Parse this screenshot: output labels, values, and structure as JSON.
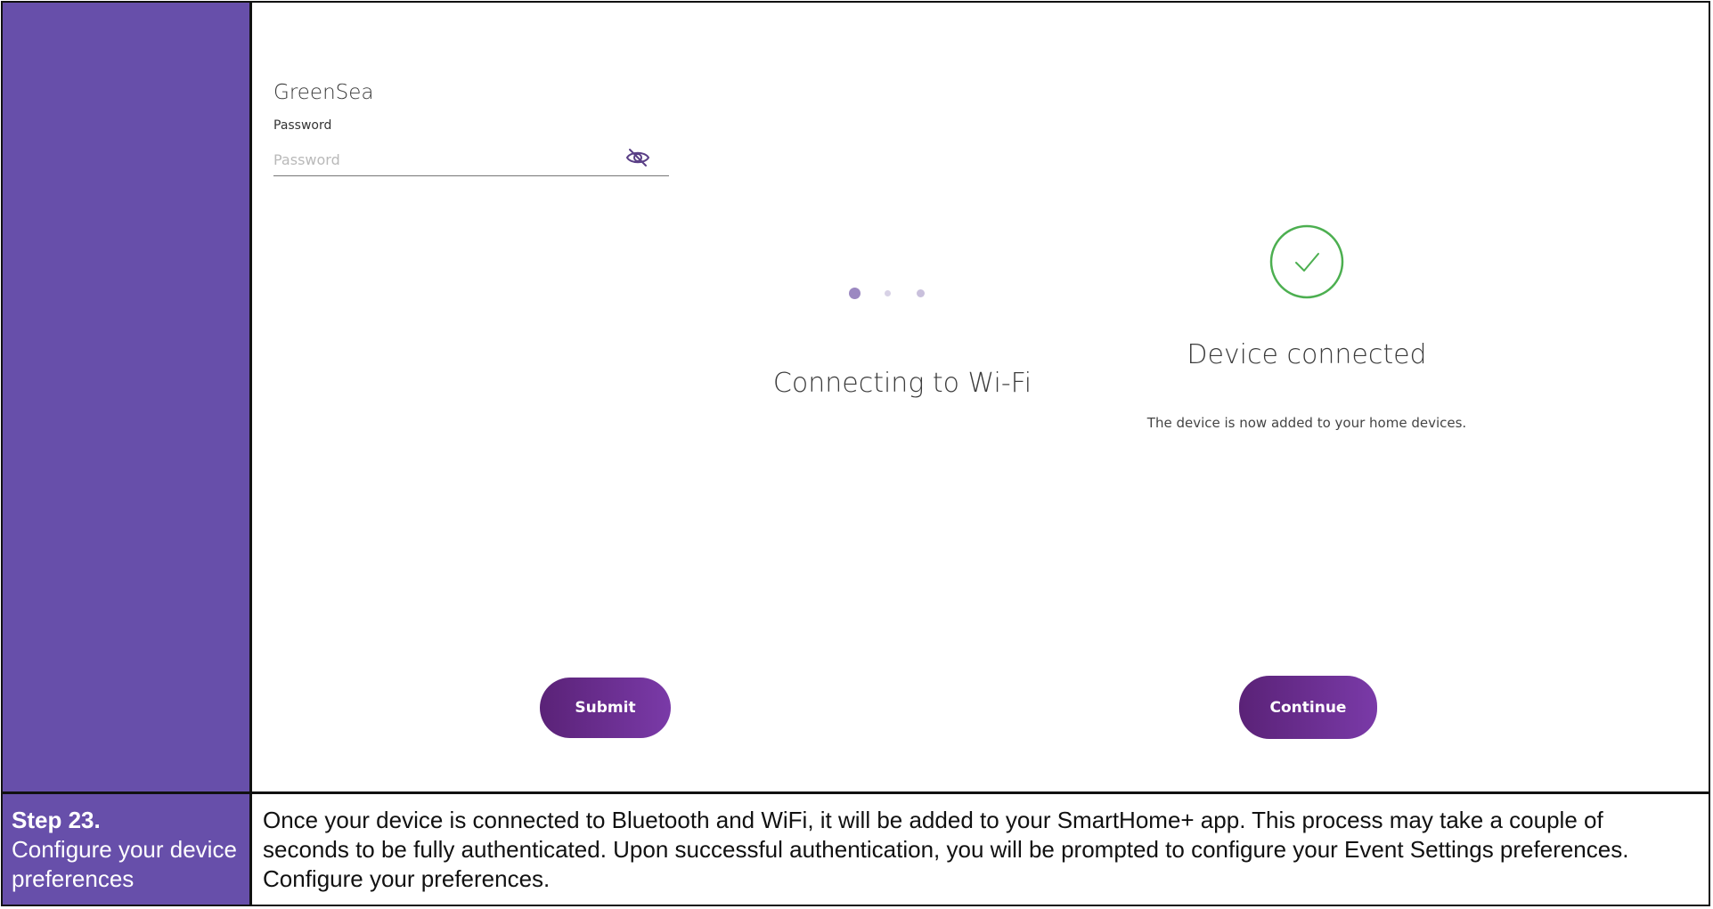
{
  "wifi": {
    "network_name": "GreenSea",
    "password_label": "Password",
    "password_placeholder": "Password",
    "password_value": "",
    "submit_label": "Submit"
  },
  "progress": {
    "status_text": "Connecting to Wi-Fi",
    "dot_colors": [
      "#9b88c1",
      "#d8d2e6",
      "#c9c0dc"
    ]
  },
  "success": {
    "title": "Device connected",
    "message": "The device is now added to your home devices.",
    "continue_label": "Continue",
    "check_color": "#4caf50"
  },
  "step": {
    "number": "Step 23.",
    "title": "Configure your device preferences",
    "description": "Once your device is connected to Bluetooth and WiFi, it will be added to your SmartHome+ app. This process may take a couple of seconds to be fully authenticated. Upon successful authentication, you will be prompted to configure your Event Settings preferences. Configure your preferences."
  },
  "colors": {
    "sidebar": "#674faa",
    "button_start": "#5a2277",
    "button_end": "#7a3aa8"
  },
  "icons": {
    "eye": "eye-slash-icon",
    "check": "check-circle-icon"
  }
}
